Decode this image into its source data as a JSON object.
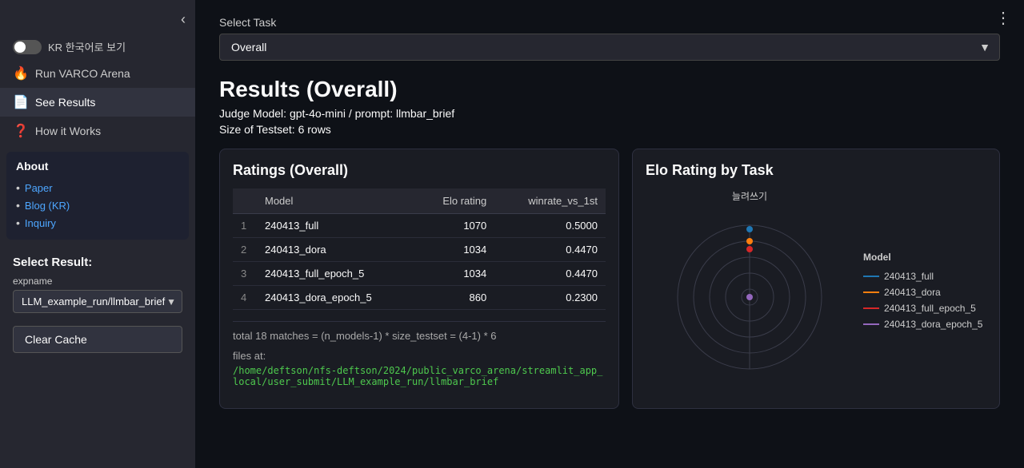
{
  "sidebar": {
    "collapse_icon": "‹",
    "toggle_label": "KR 한국어로 보기",
    "nav_items": [
      {
        "id": "run-varco",
        "icon": "🔥",
        "label": "Run VARCO Arena"
      },
      {
        "id": "see-results",
        "icon": "📄",
        "label": "See Results"
      },
      {
        "id": "how-it-works",
        "icon": "❓",
        "label": "How it Works"
      }
    ],
    "about": {
      "title": "About",
      "links": [
        {
          "label": "Paper",
          "url": "#"
        },
        {
          "label": "Blog (KR)",
          "url": "#"
        },
        {
          "label": "Inquiry",
          "url": "#"
        }
      ]
    },
    "select_result": {
      "label": "Select Result:",
      "expname_label": "expname",
      "dropdown_value": "LLM_example_run/llmbar_brief",
      "options": [
        "LLM_example_run/llmbar_brief"
      ]
    },
    "clear_cache_label": "Clear Cache"
  },
  "main": {
    "three_dots": "⋮",
    "select_task": {
      "label": "Select Task",
      "value": "Overall",
      "options": [
        "Overall"
      ]
    },
    "results_title": "Results (Overall)",
    "judge_model_text": "Judge Model: gpt-4o-mini / prompt: llmbar_brief",
    "testset_text": "Size of Testset: 6 rows",
    "ratings_card": {
      "title": "Ratings (Overall)",
      "table": {
        "columns": [
          "",
          "Model",
          "Elo rating",
          "winrate_vs_1st"
        ],
        "rows": [
          {
            "rank": 1,
            "model": "240413_full",
            "elo": "1070",
            "winrate": "0.5000"
          },
          {
            "rank": 2,
            "model": "240413_dora",
            "elo": "1034",
            "winrate": "0.4470"
          },
          {
            "rank": 3,
            "model": "240413_full_epoch_5",
            "elo": "1034",
            "winrate": "0.4470"
          },
          {
            "rank": 4,
            "model": "240413_dora_epoch_5",
            "elo": "860",
            "winrate": "0.2300"
          }
        ]
      },
      "total_matches": "total 18 matches = (n_models-1) * size_testset = (4-1) * 6",
      "files_at_label": "files at:",
      "file_path": "/home/deftson/nfs-deftson/2024/public_varco_arena/streamlit_app_local/user_submit/LLM_example_run/llmbar_brief"
    },
    "radar_card": {
      "title": "Elo Rating by Task",
      "axis_label": "늘려쓰기",
      "legend": {
        "title": "Model",
        "items": [
          {
            "label": "240413_full",
            "color": "#1f77b4"
          },
          {
            "label": "240413_dora",
            "color": "#ff7f0e"
          },
          {
            "label": "240413_full_epoch_5",
            "color": "#d62728"
          },
          {
            "label": "240413_dora_epoch_5",
            "color": "#9467bd"
          }
        ]
      }
    }
  }
}
